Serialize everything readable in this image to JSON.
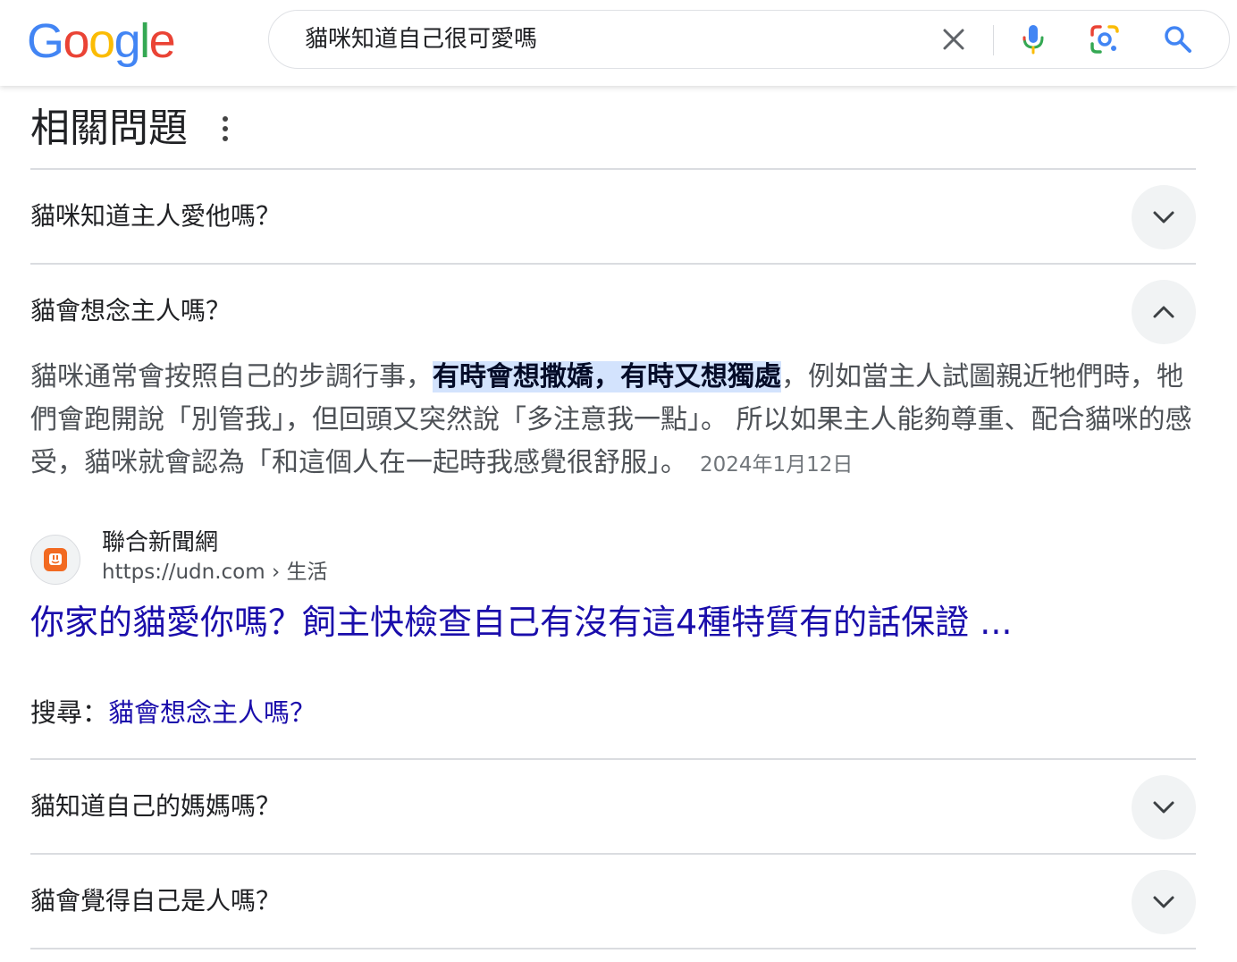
{
  "header": {
    "logo_letters": [
      {
        "char": "G",
        "color": "#4285F4"
      },
      {
        "char": "o",
        "color": "#EA4335"
      },
      {
        "char": "o",
        "color": "#FBBC05"
      },
      {
        "char": "g",
        "color": "#4285F4"
      },
      {
        "char": "l",
        "color": "#34A853"
      },
      {
        "char": "e",
        "color": "#EA4335"
      }
    ],
    "search_query": "貓咪知道自己很可愛嗎",
    "icons": [
      "clear-icon",
      "microphone-icon",
      "google-lens-icon",
      "search-icon"
    ]
  },
  "paa": {
    "title": "相關問題",
    "questions": [
      {
        "text": "貓咪知道主人愛他嗎？",
        "expanded": false
      },
      {
        "text": "貓會想念主人嗎？",
        "expanded": true
      },
      {
        "text": "貓知道自己的媽媽嗎？",
        "expanded": false
      },
      {
        "text": "貓會覺得自己是人嗎？",
        "expanded": false
      }
    ],
    "answer": {
      "before": "貓咪通常會按照自己的步調行事，",
      "highlight": "有時會想撒嬌，有時又想獨處",
      "after": "，例如當主人試圖親近牠們時，牠們會跑開說「別管我」，但回頭又突然說「多注意我一點」。 所以如果主人能夠尊重、配合貓咪的感受，貓咪就會認為「和這個人在一起時我感覺很舒服」。",
      "date": "2024年1月12日"
    },
    "source": {
      "name": "聯合新聞網",
      "url": "https://udn.com › 生活",
      "favicon_color": "#f26a21"
    },
    "result_title": "你家的貓愛你嗎？飼主快檢查自己有沒有這4種特質有的話保證 ...",
    "search_also": {
      "label": "搜尋：",
      "link": "貓會想念主人嗎？"
    }
  },
  "colors": {
    "link": "#1a0dab",
    "highlight_bg": "#d3e3fd",
    "chevron_bg": "#f1f3f4",
    "divider": "#dadce0"
  }
}
